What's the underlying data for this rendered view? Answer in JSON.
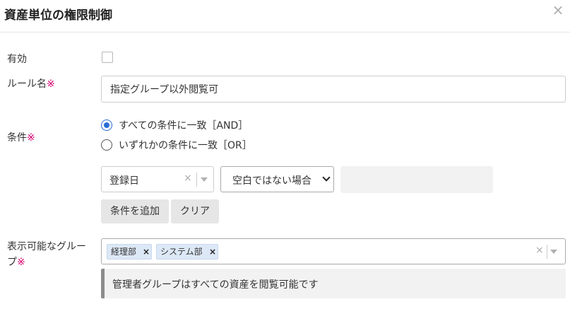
{
  "dialog": {
    "title": "資産単位の権限制御",
    "close_glyph": "×"
  },
  "form": {
    "enabled": {
      "label": "有効",
      "checked": false
    },
    "rule_name": {
      "label": "ルール名",
      "required_mark": "※",
      "value": "指定グループ以外閲覧可"
    },
    "condition": {
      "label": "条件",
      "required_mark": "※",
      "options": [
        {
          "label": "すべての条件に一致［AND］",
          "checked": true
        },
        {
          "label": "いずれかの条件に一致［OR］",
          "checked": false
        }
      ],
      "field_select": {
        "value": "登録日",
        "clear_glyph": "×"
      },
      "operator_select": {
        "value": "空白ではない場合"
      },
      "value_input": {
        "value": ""
      },
      "add_button": "条件を追加",
      "clear_button": "クリア"
    },
    "visible_groups": {
      "label_line1": "表示可能なグルー",
      "label_line2": "プ",
      "required_mark": "※",
      "tags": [
        {
          "label": "経理部",
          "remove_glyph": "×"
        },
        {
          "label": "システム部",
          "remove_glyph": "×"
        }
      ],
      "clear_glyph": "×",
      "note": "管理者グループはすべての資産を閲覧可能です"
    }
  }
}
